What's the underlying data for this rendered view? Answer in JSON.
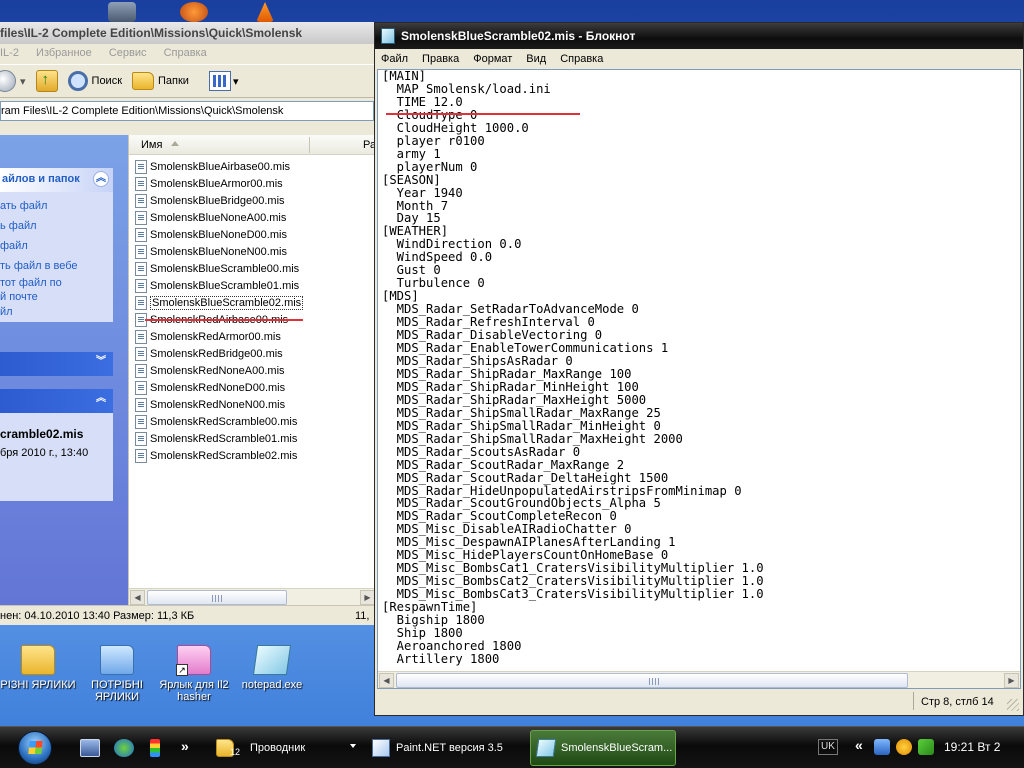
{
  "explorer": {
    "title": "files\\IL-2 Complete Edition\\Missions\\Quick\\Smolensk",
    "menu": [
      "IL-2",
      "Избранное",
      "Сервис",
      "Справка"
    ],
    "toolbar": {
      "search_label": "Поиск",
      "folders_label": "Папки"
    },
    "address": "ram Files\\IL-2 Complete Edition\\Missions\\Quick\\Smolensk",
    "tasks": {
      "file_folder_header": "айлов и папок",
      "file_tasks": [
        "ать файл",
        "ь файл",
        "файл",
        "ть файл в вебе",
        "тот файл по",
        "й почте",
        "йл"
      ],
      "other_places_header": "",
      "details_header": "",
      "details_name": "cramble02.mis",
      "details_date": "бря 2010 г., 13:40"
    },
    "list": {
      "col_name": "Имя",
      "col_size": "Ра",
      "files": [
        "SmolenskBlueAirbase00.mis",
        "SmolenskBlueArmor00.mis",
        "SmolenskBlueBridge00.mis",
        "SmolenskBlueNoneA00.mis",
        "SmolenskBlueNoneD00.mis",
        "SmolenskBlueNoneN00.mis",
        "SmolenskBlueScramble00.mis",
        "SmolenskBlueScramble01.mis",
        "SmolenskBlueScramble02.mis",
        "SmolenskRedAirbase00.mis",
        "SmolenskRedArmor00.mis",
        "SmolenskRedBridge00.mis",
        "SmolenskRedNoneA00.mis",
        "SmolenskRedNoneD00.mis",
        "SmolenskRedNoneN00.mis",
        "SmolenskRedScramble00.mis",
        "SmolenskRedScramble01.mis",
        "SmolenskRedScramble02.mis"
      ],
      "selected_file": "SmolenskBlueScramble02.mis"
    },
    "status_left": "нен: 04.10.2010 13:40 Размер: 11,3 КБ",
    "status_right": "11,"
  },
  "notepad": {
    "title": "SmolenskBlueScramble02.mis - Блокнот",
    "menu": [
      "Файл",
      "Правка",
      "Формат",
      "Вид",
      "Справка"
    ],
    "lines": [
      "[MAIN]",
      "  MAP Smolensk/load.ini",
      "  TIME 12.0",
      "  CloudType 0",
      "  CloudHeight 1000.0",
      "  player r0100",
      "  army 1",
      "  playerNum 0",
      "[SEASON]",
      "  Year 1940",
      "  Month 7",
      "  Day 15",
      "[WEATHER]",
      "  WindDirection 0.0",
      "  WindSpeed 0.0",
      "  Gust 0",
      "  Turbulence 0",
      "[MDS]",
      "  MDS_Radar_SetRadarToAdvanceMode 0",
      "  MDS_Radar_RefreshInterval 0",
      "  MDS_Radar_DisableVectoring 0",
      "  MDS_Radar_EnableTowerCommunications 1",
      "  MDS_Radar_ShipsAsRadar 0",
      "  MDS_Radar_ShipRadar_MaxRange 100",
      "  MDS_Radar_ShipRadar_MinHeight 100",
      "  MDS_Radar_ShipRadar_MaxHeight 5000",
      "  MDS_Radar_ShipSmallRadar_MaxRange 25",
      "  MDS_Radar_ShipSmallRadar_MinHeight 0",
      "  MDS_Radar_ShipSmallRadar_MaxHeight 2000",
      "  MDS_Radar_ScoutsAsRadar 0",
      "  MDS_Radar_ScoutRadar_MaxRange 2",
      "  MDS_Radar_ScoutRadar_DeltaHeight 1500",
      "  MDS_Radar_HideUnpopulatedAirstripsFromMinimap 0",
      "  MDS_Radar_ScoutGroundObjects_Alpha 5",
      "  MDS_Radar_ScoutCompleteRecon 0",
      "  MDS_Misc_DisableAIRadioChatter 0",
      "  MDS_Misc_DespawnAIPlanesAfterLanding 1",
      "  MDS_Misc_HidePlayersCountOnHomeBase 0",
      "  MDS_Misc_BombsCat1_CratersVisibilityMultiplier 1.0",
      "  MDS_Misc_BombsCat2_CratersVisibilityMultiplier 1.0",
      "  MDS_Misc_BombsCat3_CratersVisibilityMultiplier 1.0",
      "[RespawnTime]",
      "  Bigship 1800",
      "  Ship 1800",
      "  Aeroanchored 1800",
      "  Artillery 1800"
    ],
    "status_position": "Стр 8, стлб 14"
  },
  "desktop_icons": [
    {
      "label": "РІЗНІ ЯРЛИКИ",
      "icon": "folder-icon"
    },
    {
      "label": "ПОТРІБНІ ЯРЛИКИ",
      "icon": "folder-icon"
    },
    {
      "label": "Ярлык для Il2 hasher",
      "icon": "folder-shortcut-icon"
    },
    {
      "label": "notepad.exe",
      "icon": "notepad-icon"
    }
  ],
  "taskbar": {
    "quick_launch_chevron": "»",
    "buttons": [
      {
        "label": "Проводник",
        "count": "12"
      },
      {
        "label": "Paint.NET версия 3.5"
      },
      {
        "label": "SmolenskBlueScram..."
      }
    ],
    "lang": "UK",
    "tray_chevron": "«",
    "clock": "19:21 Вт 2"
  },
  "colors": {
    "highlight_underline": "#e0303a",
    "task_pane_link": "#215dc6",
    "taskbar_active": "#4a7a3a"
  }
}
